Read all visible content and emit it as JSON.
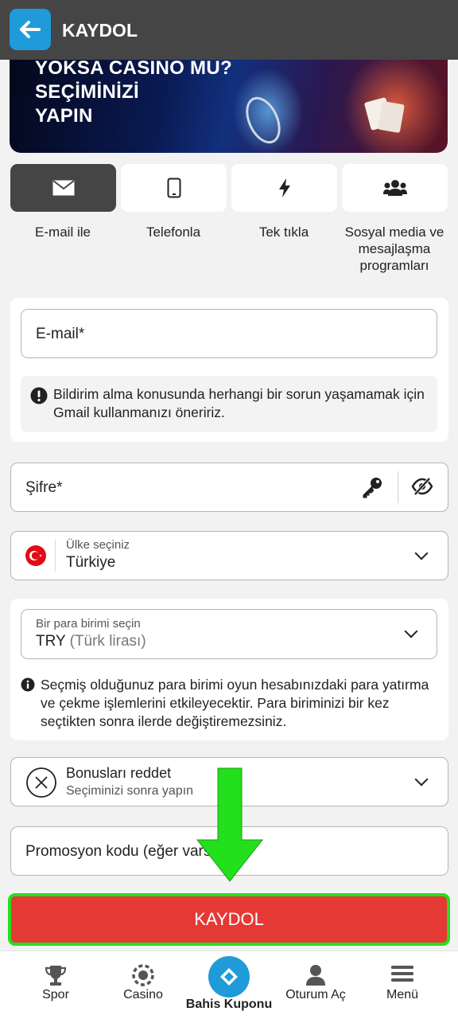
{
  "header": {
    "title": "KAYDOL"
  },
  "banner": {
    "lines": [
      "YOKSA CASINO MU?",
      "SEÇİMİNİZİ",
      "YAPIN"
    ]
  },
  "registration_methods": [
    {
      "label": "E-mail ile",
      "icon": "envelope-icon",
      "active": true
    },
    {
      "label": "Telefonla",
      "icon": "phone-icon",
      "active": false
    },
    {
      "label": "Tek tıkla",
      "icon": "lightning-icon",
      "active": false
    },
    {
      "label": "Sosyal media ve mesajlaşma programları",
      "icon": "users-icon",
      "active": false
    }
  ],
  "email": {
    "placeholder": "E-mail*",
    "note": "Bildirim alma konusunda herhangi bir sorun yaşamamak için Gmail kullanmanızı öneririz."
  },
  "password": {
    "placeholder": "Şifre*"
  },
  "country": {
    "label": "Ülke seçiniz",
    "value": "Türkiye"
  },
  "currency": {
    "label": "Bir para birimi seçin",
    "code": "TRY",
    "name": "(Türk lirası)",
    "note": "Seçmiş olduğunuz para birimi oyun hesabınızdaki para yatırma ve çekme işlemlerini etkileyecektir. Para biriminizi bir kez seçtikten sonra ilerde değiştiremezsiniz."
  },
  "bonus": {
    "title": "Bonusları reddet",
    "subtitle": "Seçiminizi sonra yapın"
  },
  "promo": {
    "placeholder": "Promosyon kodu (eğer varsa)"
  },
  "submit_label": "KAYDOL",
  "bottom_nav": [
    {
      "label": "Spor",
      "icon": "trophy-icon"
    },
    {
      "label": "Casino",
      "icon": "casino-chip-icon"
    },
    {
      "label": "Bahis Kuponu",
      "icon": "ticket-icon"
    },
    {
      "label": "Oturum Aç",
      "icon": "user-icon"
    },
    {
      "label": "Menü",
      "icon": "hamburger-menu-icon"
    }
  ],
  "colors": {
    "primary": "#1e9bd8",
    "submit": "#e53935",
    "highlight": "#22e01b",
    "header": "#454545"
  }
}
